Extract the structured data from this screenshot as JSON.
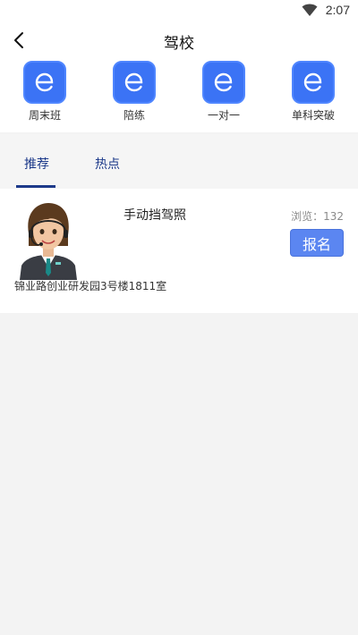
{
  "status_bar": {
    "time": "2:07"
  },
  "header": {
    "title": "驾校"
  },
  "categories": [
    {
      "label": "周末班",
      "icon": "e-icon"
    },
    {
      "label": "陪练",
      "icon": "e-icon"
    },
    {
      "label": "一对一",
      "icon": "e-icon"
    },
    {
      "label": "单科突破",
      "icon": "e-icon"
    }
  ],
  "tabs": [
    {
      "label": "推荐",
      "active": true
    },
    {
      "label": "热点",
      "active": false
    }
  ],
  "listing": {
    "name": "手动挡驾照",
    "views": "浏览：132",
    "signup_label": "报名",
    "address": "锦业路创业研发园3号楼1811室"
  },
  "colors": {
    "accent": "#3b73f5",
    "tab_text": "#1d3a8a",
    "button": "#5b86f1"
  }
}
